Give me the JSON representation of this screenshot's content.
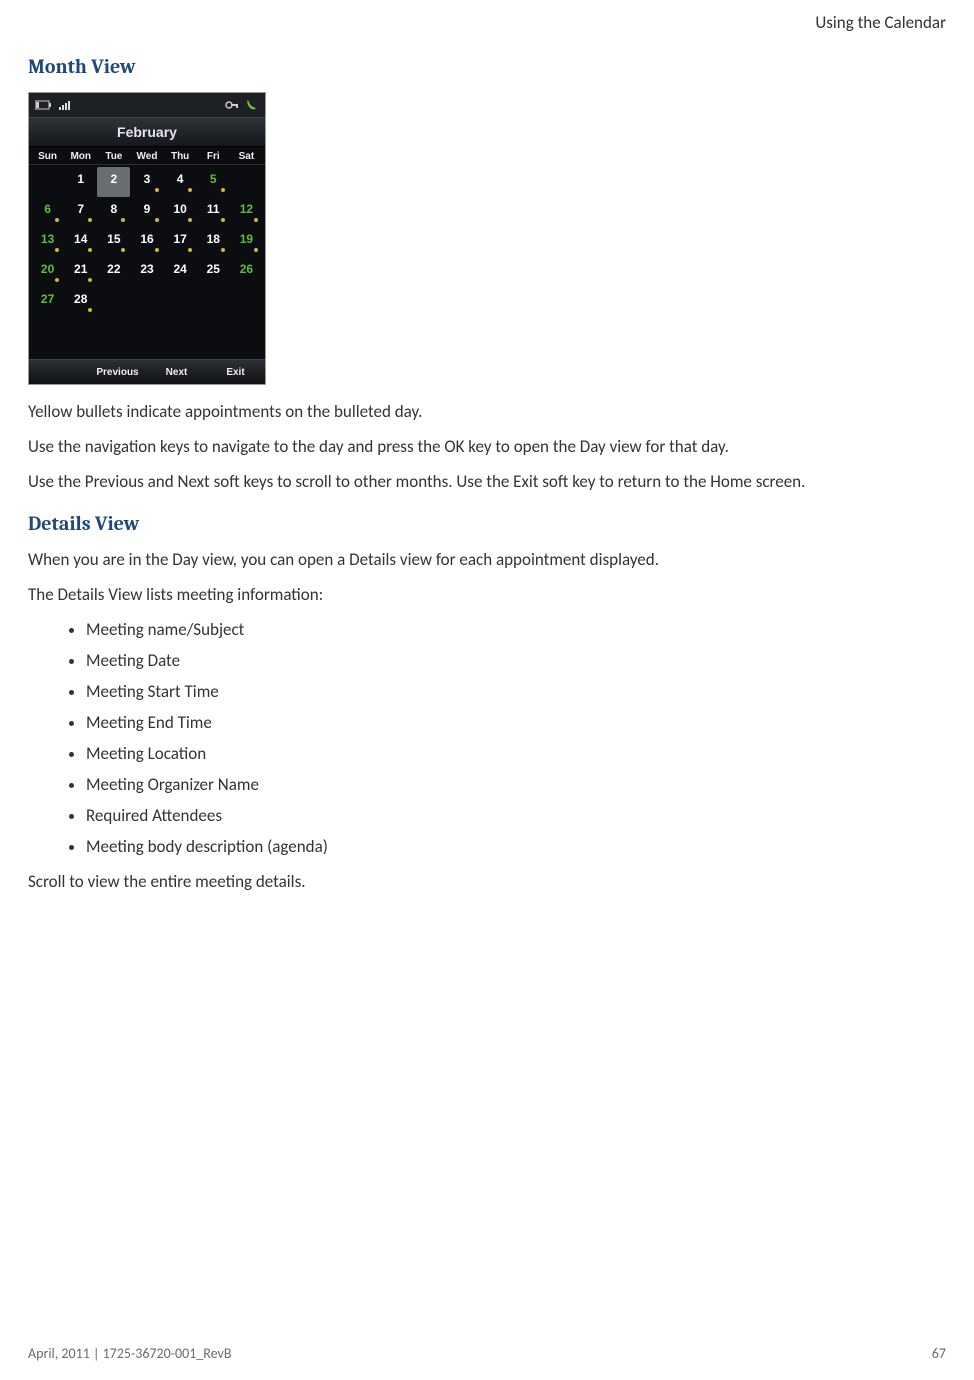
{
  "header": {
    "right": "Using the Calendar"
  },
  "section1": {
    "title": "Month View",
    "p1": "Yellow bullets indicate appointments on the bulleted day.",
    "p2": "Use the navigation keys to navigate to the day and press the OK key to open the Day view for that day.",
    "p3": "Use the Previous and Next soft keys to scroll to other months. Use the Exit soft key to return to the Home screen."
  },
  "section2": {
    "title": "Details View",
    "p1": "When you are in the Day view, you can open a Details view for each appointment displayed.",
    "p2": "The Details View lists meeting information:",
    "items": [
      "Meeting name/Subject",
      "Meeting Date",
      "Meeting Start Time",
      "Meeting End Time",
      "Meeting Location",
      "Meeting Organizer Name",
      "Required Attendees",
      "Meeting body description (agenda)"
    ],
    "p3": "Scroll to view the entire meeting details."
  },
  "phone": {
    "month": "February",
    "dow": [
      "Sun",
      "Mon",
      "Tue",
      "Wed",
      "Thu",
      "Fri",
      "Sat"
    ],
    "softkeys": [
      "",
      "Previous",
      "Next",
      "Exit"
    ],
    "cells": [
      {
        "n": "",
        "w": true
      },
      {
        "n": "1"
      },
      {
        "n": "2",
        "sel": true
      },
      {
        "n": "3",
        "d": true
      },
      {
        "n": "4",
        "d": true
      },
      {
        "n": "5",
        "w": true,
        "d": true
      },
      {
        "n": "",
        "w": true
      },
      {
        "n": "6",
        "w": true,
        "d": true
      },
      {
        "n": "7",
        "d": true
      },
      {
        "n": "8",
        "d": true
      },
      {
        "n": "9",
        "d": true
      },
      {
        "n": "10",
        "d": true
      },
      {
        "n": "11",
        "d": true
      },
      {
        "n": "12",
        "w": true,
        "d": true
      },
      {
        "n": "13",
        "w": true,
        "d": true
      },
      {
        "n": "14",
        "d": true
      },
      {
        "n": "15",
        "d": true
      },
      {
        "n": "16",
        "d": true
      },
      {
        "n": "17",
        "d": true
      },
      {
        "n": "18",
        "d": true
      },
      {
        "n": "19",
        "w": true,
        "d": true
      },
      {
        "n": "20",
        "w": true,
        "d": true
      },
      {
        "n": "21",
        "d": true
      },
      {
        "n": "22"
      },
      {
        "n": "23"
      },
      {
        "n": "24"
      },
      {
        "n": "25"
      },
      {
        "n": "26",
        "w": true
      },
      {
        "n": "27",
        "w": true
      },
      {
        "n": "28",
        "d": true
      },
      {
        "n": ""
      },
      {
        "n": ""
      },
      {
        "n": ""
      },
      {
        "n": ""
      },
      {
        "n": ""
      }
    ]
  },
  "footer": {
    "left": "April, 2011  |  1725-36720-001_RevB",
    "right": "67"
  }
}
